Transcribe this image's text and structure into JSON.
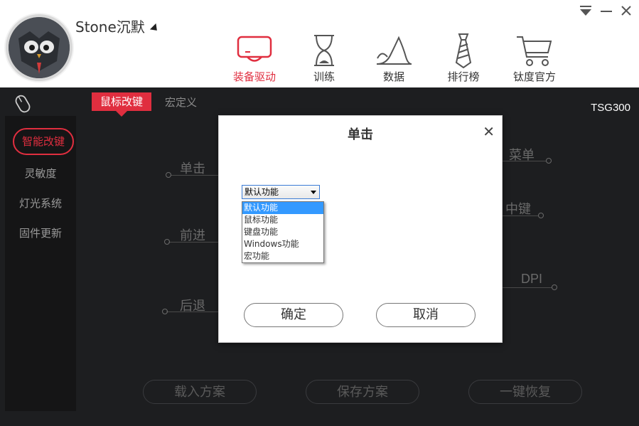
{
  "user": {
    "name": "Stone沉默"
  },
  "nav": [
    {
      "label": "装备驱动",
      "icon": "device-driver-icon",
      "active": true
    },
    {
      "label": "训练",
      "icon": "hourglass-icon",
      "active": false
    },
    {
      "label": "数据",
      "icon": "curve-chart-icon",
      "active": false
    },
    {
      "label": "排行榜",
      "icon": "tie-icon",
      "active": false
    },
    {
      "label": "钛度官方",
      "icon": "shopping-cart-icon",
      "active": false
    }
  ],
  "tabs": {
    "active": "鼠标改键",
    "inactive": "宏定义"
  },
  "model": "TSG300",
  "sidebar": [
    "智能改键",
    "灵敏度",
    "灯光系统",
    "固件更新"
  ],
  "buttons_left": [
    "单击",
    "前进",
    "后退"
  ],
  "buttons_right": [
    "菜单",
    "中键",
    "DPI"
  ],
  "bottom": [
    "载入方案",
    "保存方案",
    "一键恢复"
  ],
  "dialog": {
    "title": "单击",
    "selected": "默认功能",
    "options": [
      "默认功能",
      "鼠标功能",
      "键盘功能",
      "Windows功能",
      "宏功能"
    ],
    "confirm": "确定",
    "cancel": "取消"
  },
  "colors": {
    "accent": "#e02e3f",
    "bg": "#1d1e20",
    "select_highlight": "#3399ff"
  }
}
